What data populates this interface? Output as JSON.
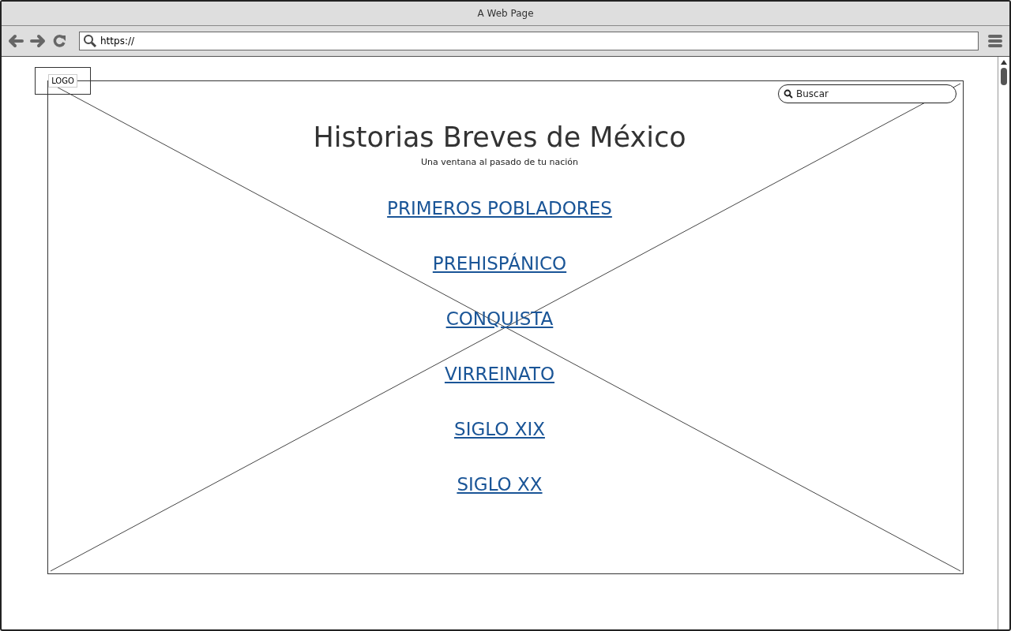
{
  "window": {
    "title": "A Web Page"
  },
  "address_bar": {
    "value": "https://"
  },
  "logo": {
    "text": "LOGO"
  },
  "search": {
    "placeholder": "Buscar"
  },
  "heading": "Historias Breves de México",
  "subtitle": "Una ventana al pasado de tu nación",
  "links": [
    {
      "label": "PRIMEROS POBLADORES"
    },
    {
      "label": "PREHISPÁNICO"
    },
    {
      "label": "CONQUISTA"
    },
    {
      "label": "VIRREINATO"
    },
    {
      "label": "SIGLO XIX"
    },
    {
      "label": "SIGLO XX"
    }
  ]
}
